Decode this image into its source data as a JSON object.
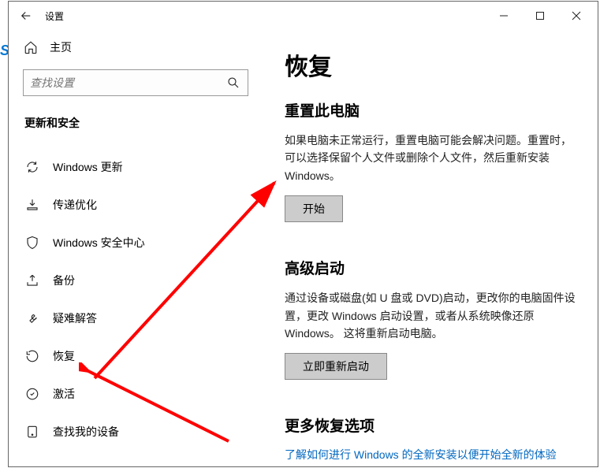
{
  "window": {
    "title": "设置"
  },
  "sidebar": {
    "home": "主页",
    "search_placeholder": "查找设置",
    "section": "更新和安全",
    "items": [
      {
        "label": "Windows 更新"
      },
      {
        "label": "传递优化"
      },
      {
        "label": "Windows 安全中心"
      },
      {
        "label": "备份"
      },
      {
        "label": "疑难解答"
      },
      {
        "label": "恢复"
      },
      {
        "label": "激活"
      },
      {
        "label": "查找我的设备"
      }
    ]
  },
  "main": {
    "title": "恢复",
    "reset": {
      "heading": "重置此电脑",
      "desc": "如果电脑未正常运行，重置电脑可能会解决问题。重置时，可以选择保留个人文件或删除个人文件，然后重新安装 Windows。",
      "button": "开始"
    },
    "advanced": {
      "heading": "高级启动",
      "desc": "通过设备或磁盘(如 U 盘或 DVD)启动，更改你的电脑固件设置，更改 Windows 启动设置，或者从系统映像还原 Windows。  这将重新启动电脑。",
      "button": "立即重新启动"
    },
    "more": {
      "heading": "更多恢复选项",
      "link": "了解如何进行 Windows 的全新安装以便开始全新的体验"
    }
  }
}
